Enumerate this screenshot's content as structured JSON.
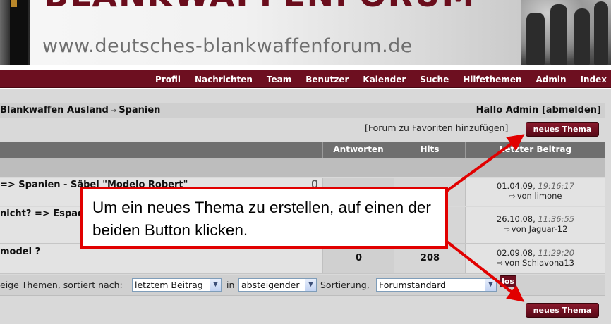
{
  "banner": {
    "title": "BLANKWAFFENFORUM",
    "url": "www.deutsches-blankwaffenforum.de"
  },
  "nav": {
    "items": [
      "Profil",
      "Nachrichten",
      "Team",
      "Benutzer",
      "Kalender",
      "Suche",
      "Hilfethemen",
      "Admin",
      "Index"
    ]
  },
  "breadcrumb": {
    "parent": "Blankwaffen Ausland",
    "separator": "→",
    "current": "Spanien"
  },
  "user": {
    "greeting": "Hallo Admin [abmelden]"
  },
  "forum_actions": {
    "favorites_link": "[Forum zu Favoriten hinzufügen]",
    "new_topic_label": "neues Thema"
  },
  "table": {
    "headers": {
      "answers": "Antworten",
      "hits": "Hits",
      "last_post": "Letzter Beitrag"
    },
    "rows": [
      {
        "title": "=> Spanien - Säbel \"Modelo Robert\"",
        "answers": "",
        "hits": "",
        "last_date": "01.04.09,",
        "last_time": "19:16:17",
        "last_by": "von limone"
      },
      {
        "title": "nicht? => Espada",
        "answers": "",
        "hits": "",
        "last_date": "26.10.08,",
        "last_time": "11:36:55",
        "last_by": "von Jaguar-12"
      },
      {
        "title": "model ?",
        "answers": "0",
        "hits": "208",
        "last_date": "02.09.08,",
        "last_time": "11:29:20",
        "last_by": "von Schiavona13"
      }
    ]
  },
  "sort": {
    "label_prefix": "eige Themen, sortiert nach:",
    "sort_by_value": "letztem Beitrag",
    "label_in": "in",
    "order_value": "absteigender",
    "label_sort": "Sortierung,",
    "filter_value": "Forumstandard",
    "go_label": "los"
  },
  "annotation": {
    "text": "Um ein neues Thema zu erstellen, auf einen der beiden Button klicken.",
    "color": "#e10000"
  },
  "colors": {
    "brand": "#6d0f20",
    "header_gray": "#6f6f6f"
  }
}
